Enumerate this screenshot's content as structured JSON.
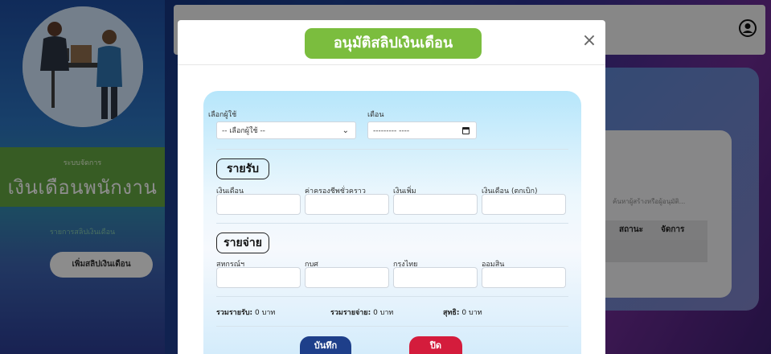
{
  "sidebar": {
    "brand_sub": "ระบบจัดการ",
    "brand_title": "เงินเดือนพนักงาน",
    "link_label": "รายการสลิปเงินเดือน",
    "add_button": "เพิ่มสลิปเงินเดือน"
  },
  "background": {
    "search_placeholder": "ค้นหาผู้สร้างหรือผู้อนุมัติ...",
    "columns": [
      "สถานะ",
      "จัดการ"
    ]
  },
  "modal": {
    "title": "อนุมัติสลิปเงินเดือน",
    "close_glyph": "×",
    "user_label": "เลือกผู้ใช้",
    "user_select_value": "-- เลือกผู้ใช้ --",
    "month_label": "เดือน",
    "month_value": "--------- ----",
    "income": {
      "heading": "รายรับ",
      "fields": [
        "เงินเดือน",
        "ค่าครองชีพชั่วคราว",
        "เงินเพิ่ม",
        "เงินเดือน (ตกเบิก)"
      ]
    },
    "expense": {
      "heading": "รายจ่าย",
      "fields": [
        "สหกรณ์ฯ",
        "กบศ",
        "กรุงไทย",
        "ออมสิน"
      ]
    },
    "summary": {
      "income_label": "รวมรายรับ:",
      "income_value": "0 บาท",
      "expense_label": "รวมรายจ่าย:",
      "expense_value": "0 บาท",
      "net_label": "สุทธิ:",
      "net_value": "0 บาท"
    },
    "save_button": "บันทึก",
    "close_button": "ปิด"
  },
  "colors": {
    "title_green": "#7bbd3e",
    "save_navy": "#1e3f8a",
    "close_red": "#d41c3c",
    "brand_green": "#5f9f3f"
  }
}
